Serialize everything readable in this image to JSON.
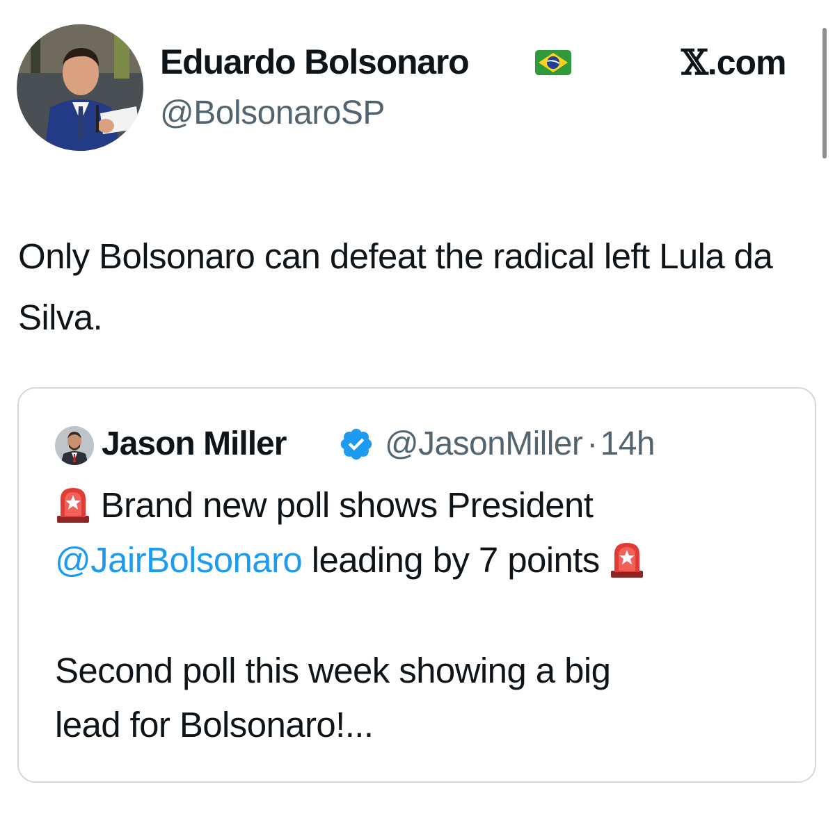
{
  "header": {
    "author_name": "Eduardo Bolsonaro",
    "author_flag_icon": "brazil-flag-icon",
    "author_handle": "@BolsonaroSP",
    "brand_x": "𝕏",
    "brand_rest": ".com"
  },
  "tweet": {
    "text": "Only Bolsonaro can defeat the radical left Lula da Silva."
  },
  "quoted_tweet": {
    "author_name": "Jason Miller",
    "verified_icon": "verified-badge-icon",
    "author_handle": "@JasonMiller",
    "separator": "·",
    "time": "14h",
    "line1_text": "Brand new poll shows President",
    "line2_mention": "@JairBolsonaro",
    "line2_text": " leading by 7 points",
    "line3_text": "Second poll this week showing a big",
    "line4_text": "lead for Bolsonaro!...",
    "emoji_icon": "rotating-light-icon"
  },
  "colors": {
    "text": "#0f1419",
    "secondary": "#536471",
    "link": "#1d9bf0",
    "border": "#cfd9de",
    "verified": "#1d9bf0"
  }
}
